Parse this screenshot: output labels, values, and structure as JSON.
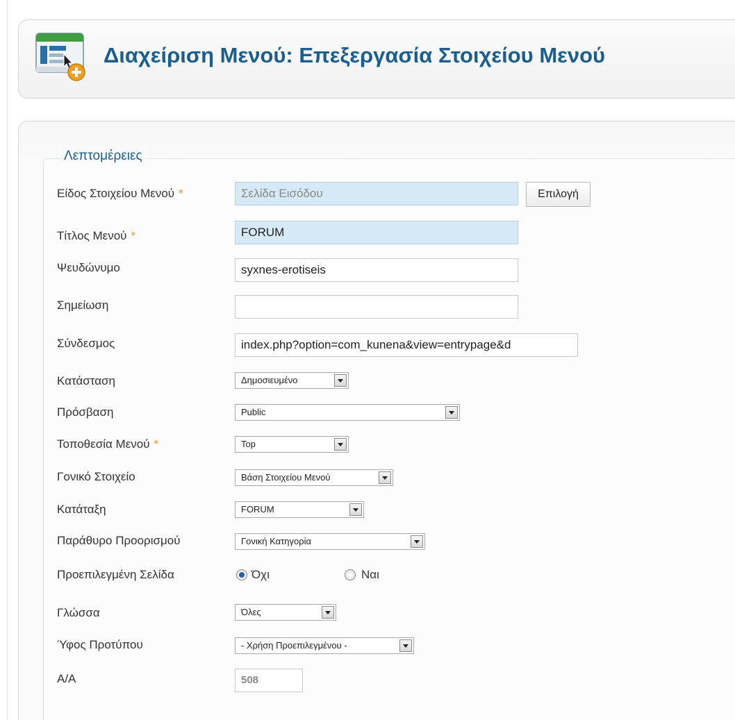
{
  "header": {
    "title": "Διαχείριση Μενού: Επεξεργασία Στοιχείου Μενού",
    "icon": "menu-item-edit-icon"
  },
  "form": {
    "legend": "Λεπτομέρειες",
    "required_marker": "*",
    "fields": {
      "type": {
        "label": "Είδος Στοιχείου Μενού",
        "value": "Σελίδα Εισόδου",
        "button": "Επιλογή"
      },
      "title": {
        "label": "Τίτλος Μενού",
        "value": "FORUM"
      },
      "alias": {
        "label": "Ψευδώνυμο",
        "value": "syxnes-erotiseis"
      },
      "note": {
        "label": "Σημείωση",
        "value": ""
      },
      "link": {
        "label": "Σύνδεσμος",
        "value": "index.php?option=com_kunena&view=entrypage&d"
      },
      "status": {
        "label": "Κατάσταση",
        "value": "Δημοσιευμένο"
      },
      "access": {
        "label": "Πρόσβαση",
        "value": "Public"
      },
      "menu_location": {
        "label": "Τοποθεσία Μενού",
        "value": "Top"
      },
      "parent": {
        "label": "Γονικό Στοιχείο",
        "value": "Βάση Στοιχείου Μενού"
      },
      "ordering": {
        "label": "Κατάταξη",
        "value": "FORUM"
      },
      "target_window": {
        "label": "Παράθυρο Προορισμού",
        "value": "Γονική Κατηγορία"
      },
      "default_page": {
        "label": "Προεπιλεγμένη Σελίδα",
        "options": [
          "Όχι",
          "Ναι"
        ],
        "selected": "Όχι"
      },
      "language": {
        "label": "Γλώσσα",
        "value": "Όλες"
      },
      "template_style": {
        "label": "Ύφος Προτύπου",
        "value": "- Χρήση Προεπιλεγμένου -"
      },
      "id": {
        "label": "Α/Α",
        "value": "508"
      }
    }
  },
  "colors": {
    "title": "#1b5d8c",
    "required": "#e89a1f",
    "highlight_field": "#d5e9f7"
  }
}
